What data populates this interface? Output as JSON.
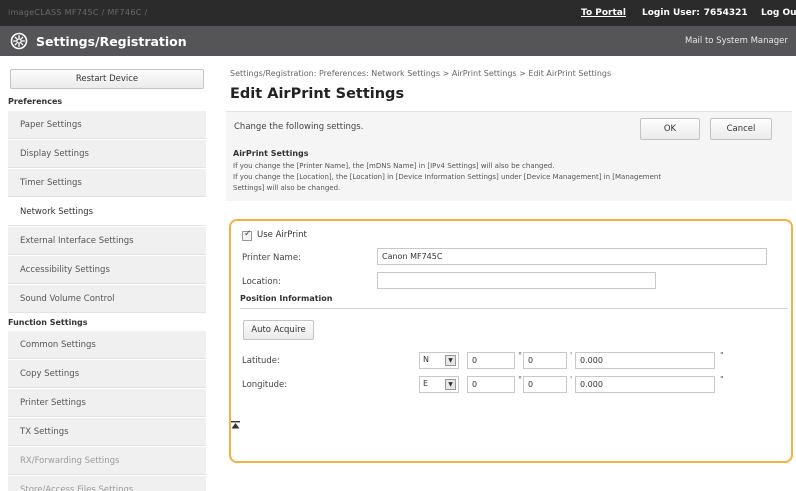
{
  "header": {
    "device_name": "imageCLASS MF745C / MF746C /",
    "portal_link": "To Portal",
    "login_label": "Login User:",
    "login_user": "7654321",
    "logout": "Log Out"
  },
  "titlebar": {
    "title": "Settings/Registration",
    "mail_link": "Mail to System Manager"
  },
  "sidebar": {
    "restart_label": "Restart Device",
    "preferences_head": "Preferences",
    "function_head": "Function Settings",
    "preferences_items": [
      {
        "label": "Paper Settings"
      },
      {
        "label": "Display Settings"
      },
      {
        "label": "Timer Settings"
      },
      {
        "label": "Network Settings"
      },
      {
        "label": "External Interface Settings"
      },
      {
        "label": "Accessibility Settings"
      },
      {
        "label": "Sound Volume Control"
      }
    ],
    "function_items": [
      {
        "label": "Common Settings"
      },
      {
        "label": "Copy Settings"
      },
      {
        "label": "Printer Settings"
      },
      {
        "label": "TX Settings"
      },
      {
        "label": "RX/Forwarding Settings"
      },
      {
        "label": "Store/Access Files Settings"
      }
    ]
  },
  "main": {
    "breadcrumb": "Settings/Registration: Preferences: Network Settings > AirPrint Settings > Edit AirPrint Settings",
    "title": "Edit AirPrint Settings",
    "instruction": "Change the following settings.",
    "ok_label": "OK",
    "cancel_label": "Cancel",
    "section_label": "AirPrint Settings",
    "notes": [
      "If you change the [Printer Name], the [mDNS Name] in [IPv4 Settings] will also be changed.",
      "If you change the [Location], the [Location] in [Device Information Settings] under [Device Management] in [Management",
      "Settings] will also be changed."
    ]
  },
  "form": {
    "use_airprint_label": "Use AirPrint",
    "use_airprint_checked": true,
    "printer_name_label": "Printer Name:",
    "printer_name_value": "Canon MF745C",
    "location_label": "Location:",
    "location_value": "",
    "position_head": "Position Information",
    "auto_acquire_label": "Auto Acquire",
    "latitude": {
      "label": "Latitude:",
      "direction": "N",
      "degrees": "0",
      "minutes": "0",
      "seconds": "0.000"
    },
    "longitude": {
      "label": "Longitude:",
      "direction": "E",
      "degrees": "0",
      "minutes": "0",
      "seconds": "0.000"
    }
  },
  "icons": {
    "settings": "gear-icon",
    "select_arrow": "dropdown-arrow-icon",
    "back_to_top": "to-top-icon"
  },
  "colors": {
    "highlight_border": "#f2b24a",
    "topbar": "#2b2b2b",
    "titlebar": "#555558"
  }
}
